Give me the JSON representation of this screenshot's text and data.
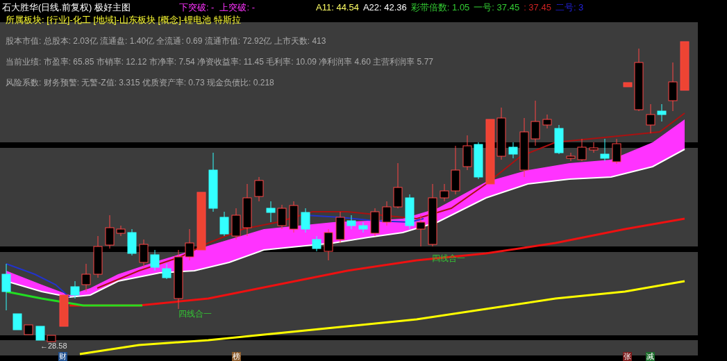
{
  "title": "石大胜华(日线.前复权) 极好主图",
  "breakout": [
    "下突破: -",
    "上突破: -"
  ],
  "indicators": [
    {
      "text": "A11: 44.54",
      "color": "#ffff66"
    },
    {
      "text": "A22: 42.36",
      "color": "#ffffff"
    },
    {
      "text": "彩带倍数: 1.05",
      "color": "#33cc33"
    },
    {
      "text": "一号: 37.45",
      "color": "#33cc33"
    },
    {
      "text": ": 37.45",
      "color": "#cc2222"
    },
    {
      "text": "二号: 3",
      "color": "#2222dd"
    }
  ],
  "sector_line": "所属板块: [行业]-化工 [地域]-山东板块 [概念]-锂电池 特斯拉",
  "info_lines": [
    "股本市值: 总股本: 2.03亿 流通盘: 1.40亿 全流通: 0.69 流通市值: 72.92亿 上市天数: 413",
    "当前业绩: 市盈率: 65.85 市销率: 12.12 市净率: 7.54 净资收益率: 11.45 毛利率: 10.09 净利润率 4.60 主营利润率 5.77",
    "风险系数: 财务预警: 无警-Z值: 3.315 优质资产率: 0.73 现金负债比: 0.218"
  ],
  "chart_labels": [
    "四线合一",
    "四线合一"
  ],
  "low_label": "←28.58",
  "bottom_markers": [
    {
      "text": "财",
      "color": "#1f4f8f"
    },
    {
      "text": "榜",
      "color": "#8a5a2a"
    },
    {
      "text": "张",
      "color": "#7a1a1a"
    },
    {
      "text": "减",
      "color": "#1a6a2a"
    }
  ]
}
